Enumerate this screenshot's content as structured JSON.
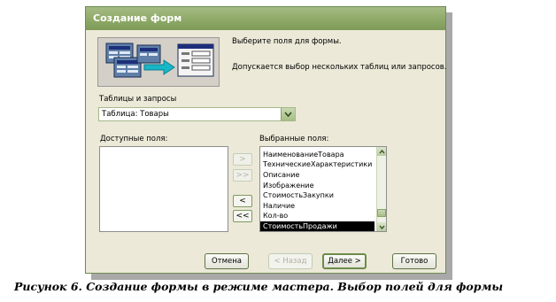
{
  "window": {
    "title": "Создание форм"
  },
  "info": {
    "line1": "Выберите поля для формы.",
    "line2": "Допускается выбор нескольких таблиц или запросов."
  },
  "tables": {
    "label": "Таблицы и запросы",
    "selected": "Таблица: Товары"
  },
  "available": {
    "label": "Доступные поля:",
    "items": []
  },
  "selected_fields": {
    "label": "Выбранные поля:",
    "items": [
      "НаименованиеТовара",
      "ТехническиеХарактеристики",
      "Описание",
      "Изображение",
      "СтоимостьЗакупки",
      "Наличие",
      "Кол-во",
      "СтоимостьПродажи"
    ],
    "highlighted": "СтоимостьПродажи"
  },
  "move": {
    "add_one": ">",
    "add_all": ">>",
    "remove_one": "<",
    "remove_all": "<<"
  },
  "buttons": {
    "cancel": "Отмена",
    "back": "< Назад",
    "next": "Далее >",
    "finish": "Готово"
  },
  "caption": "Рисунок 6. Создание формы в режиме мастера. Выбор полей для формы",
  "colors": {
    "titlebar": "#8da866",
    "dialog_bg": "#ece9d8",
    "selection": "#000000"
  }
}
